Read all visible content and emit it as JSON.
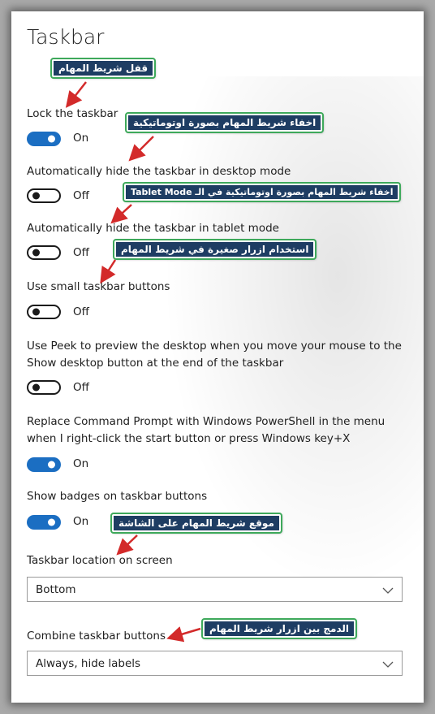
{
  "page": {
    "title": "Taskbar"
  },
  "settings": {
    "lock": {
      "label": "Lock the taskbar",
      "state": "On"
    },
    "autohide_desktop": {
      "label": "Automatically hide the taskbar in desktop mode",
      "state": "Off"
    },
    "autohide_tablet": {
      "label": "Automatically hide the taskbar in tablet mode",
      "state": "Off"
    },
    "small_buttons": {
      "label": "Use small taskbar buttons",
      "state": "Off"
    },
    "peek": {
      "label": "Use Peek to preview the desktop when you move your mouse to the Show desktop button at the end of the taskbar",
      "state": "Off"
    },
    "powershell": {
      "label": "Replace Command Prompt with Windows PowerShell in the menu when I right-click the start button or press Windows key+X",
      "state": "On"
    },
    "badges": {
      "label": "Show badges on taskbar buttons",
      "state": "On"
    },
    "location": {
      "label": "Taskbar location on screen",
      "value": "Bottom"
    },
    "combine": {
      "label": "Combine taskbar buttons",
      "value": "Always, hide labels"
    }
  },
  "callouts": {
    "lock": "قفل شريط المهام",
    "autohide_desktop": "اخفاء شريط المهام بصورة اوتوماتيكية",
    "autohide_tablet": "اخفاء شريط المهام بصورة اوتوماتيكية في الـ Tablet Mode",
    "small_buttons": "استخدام ازرار صغيرة في شريط المهام",
    "location": "موقع شريط المهام على الشاشة",
    "combine": "الدمج بين ازرار شريط المهام"
  },
  "colors": {
    "accent": "#1b6ec2",
    "callout_bg": "#1e3d63",
    "callout_border": "#3ea95b",
    "arrow": "#d32a2a"
  }
}
